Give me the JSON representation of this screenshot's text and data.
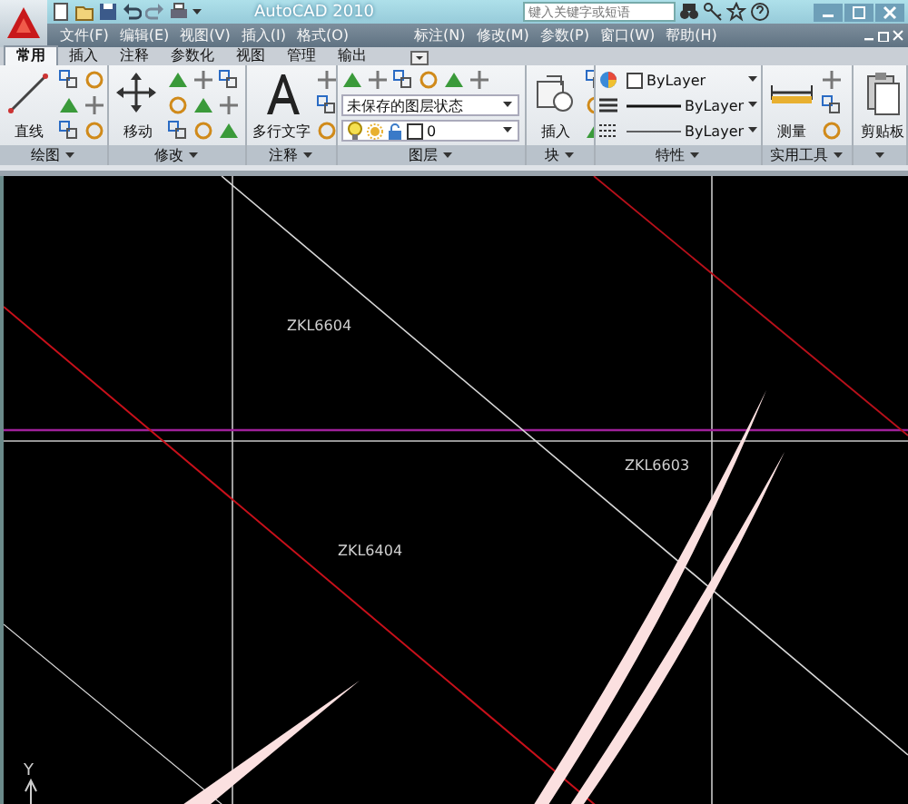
{
  "title_bar": {
    "title": "AutoCAD 2010",
    "search": {
      "placeholder": "键入关键字或短语"
    }
  },
  "menu": [
    {
      "label": "文件(F)"
    },
    {
      "label": "编辑(E)"
    },
    {
      "label": "视图(V)"
    },
    {
      "label": "插入(I)"
    },
    {
      "label": "格式(O)"
    },
    {
      "label": "标注(N)"
    },
    {
      "label": "修改(M)"
    },
    {
      "label": "参数(P)"
    },
    {
      "label": "窗口(W)"
    },
    {
      "label": "帮助(H)"
    }
  ],
  "ribbon_tabs": [
    {
      "label": "常用",
      "selected": true
    },
    {
      "label": "插入",
      "selected": false
    },
    {
      "label": "注释",
      "selected": false
    },
    {
      "label": "参数化",
      "selected": false
    },
    {
      "label": "视图",
      "selected": false
    },
    {
      "label": "管理",
      "selected": false
    },
    {
      "label": "输出",
      "selected": false
    }
  ],
  "ribbon_panels": [
    {
      "kind": "large",
      "title": "绘图",
      "button": "直线"
    },
    {
      "kind": "large",
      "title": "修改",
      "button": "移动"
    },
    {
      "kind": "text",
      "title": "注释",
      "button": "多行文字"
    },
    {
      "kind": "layers",
      "title": "图层",
      "state": "未保存的图层状态",
      "layer": "0"
    },
    {
      "kind": "large",
      "title": "块",
      "button": "插入"
    },
    {
      "kind": "properties",
      "title": "特性",
      "rows": [
        {
          "kind": "color",
          "value": "ByLayer"
        },
        {
          "kind": "lineweight",
          "value": "ByLayer"
        },
        {
          "kind": "linetype",
          "value": "ByLayer"
        }
      ]
    },
    {
      "kind": "large",
      "title": "实用工具",
      "button": "测量"
    },
    {
      "kind": "paste",
      "button": "剪贴板"
    }
  ],
  "drawing": {
    "labels": [
      {
        "text": "ZKL6604"
      },
      {
        "text": "ZKL6603"
      },
      {
        "text": "ZKL6404"
      }
    ],
    "ucs_label": "Y"
  }
}
